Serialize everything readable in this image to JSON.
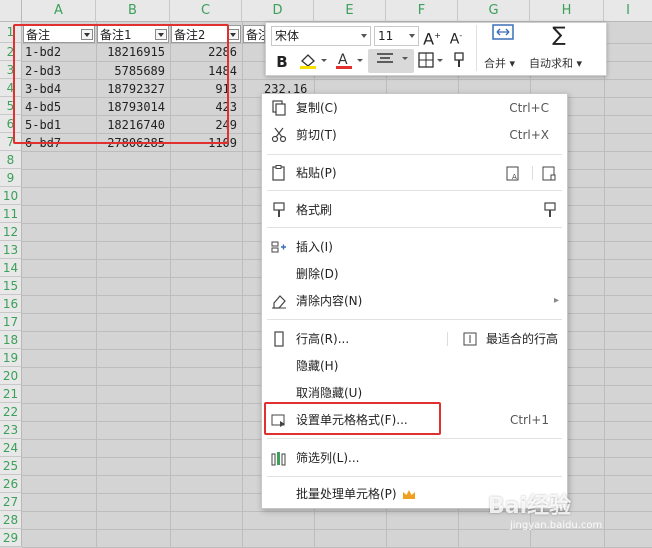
{
  "columns": [
    "A",
    "B",
    "C",
    "D",
    "E",
    "F",
    "G",
    "H",
    "I"
  ],
  "rows": [
    "1",
    "2",
    "3",
    "4",
    "5",
    "6",
    "7",
    "8",
    "9",
    "10",
    "11",
    "12",
    "13",
    "14",
    "15",
    "16",
    "17",
    "18",
    "19",
    "20",
    "21",
    "22",
    "23",
    "24",
    "25",
    "26",
    "27",
    "28",
    "29"
  ],
  "headers": [
    "备注",
    "备注1",
    "备注2",
    "备注"
  ],
  "data": [
    [
      "1-bd2",
      "18216915",
      "2286"
    ],
    [
      "2-bd3",
      "5785689",
      "1484"
    ],
    [
      "3-bd4",
      "18792327",
      "913"
    ],
    [
      "4-bd5",
      "18793014",
      "423"
    ],
    [
      "5-bd1",
      "18216740",
      "249"
    ],
    [
      "6-bd7",
      "27806285",
      "1109"
    ]
  ],
  "d_extra": "232.16",
  "toolbar": {
    "font_name": "宋体",
    "font_size": "11",
    "bold": "B",
    "merge_label": "合并",
    "autosum_label": "自动求和"
  },
  "menu": {
    "copy": "复制(C)",
    "copy_sc": "Ctrl+C",
    "cut": "剪切(T)",
    "cut_sc": "Ctrl+X",
    "paste": "粘贴(P)",
    "format_painter": "格式刷",
    "insert": "插入(I)",
    "delete": "删除(D)",
    "clear": "清除内容(N)",
    "row_height": "行高(R)...",
    "best_fit": "最适合的行高",
    "hide": "隐藏(H)",
    "unhide": "取消隐藏(U)",
    "format_cells": "设置单元格格式(F)...",
    "format_cells_sc": "Ctrl+1",
    "filter": "筛选列(L)...",
    "batch": "批量处理单元格(P)"
  },
  "watermark": {
    "brand": "Bai经验",
    "url": "jingyan.baidu.com"
  },
  "colors": {
    "header_text": "#3aa05a",
    "highlight": "#e03030",
    "crown": "#f0a020"
  }
}
